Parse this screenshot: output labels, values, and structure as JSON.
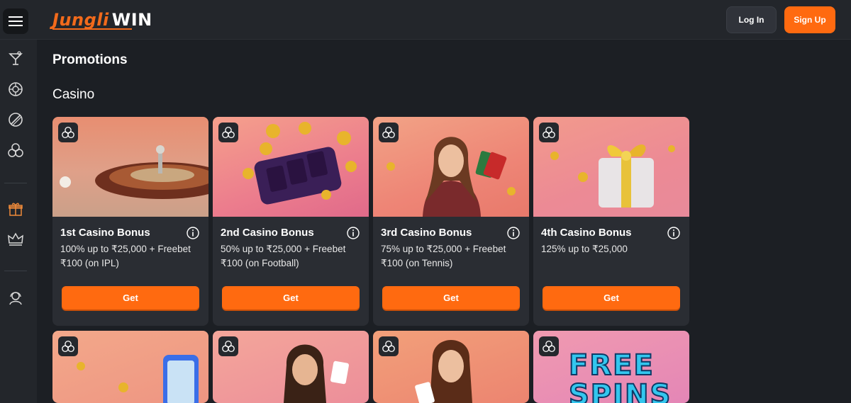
{
  "header": {
    "logo_part1": "Jungli",
    "logo_part2": "WIN",
    "login_label": "Log In",
    "signup_label": "Sign Up"
  },
  "sidebar": {
    "items": [
      {
        "icon": "cocktail-icon"
      },
      {
        "icon": "roulette-icon"
      },
      {
        "icon": "cricket-icon"
      },
      {
        "icon": "casino-chips-icon"
      },
      {
        "icon": "gift-icon"
      },
      {
        "icon": "crown-icon"
      },
      {
        "icon": "support-agent-icon"
      }
    ]
  },
  "main": {
    "page_title": "Promotions",
    "section_title": "Casino",
    "cards": [
      {
        "title": "1st Casino Bonus",
        "desc": "100% up to ₹25,000 + Freebet ₹100 (on IPL)",
        "button": "Get"
      },
      {
        "title": "2nd Casino Bonus",
        "desc": "50% up to ₹25,000 + Freebet ₹100 (on Football)",
        "button": "Get"
      },
      {
        "title": "3rd Casino Bonus",
        "desc": "75% up to ₹25,000 + Freebet ₹100 (on Tennis)",
        "button": "Get"
      },
      {
        "title": "4th Casino Bonus",
        "desc": "125% up to ₹25,000",
        "button": "Get"
      }
    ],
    "row2": {
      "free_spins_text": "FREE SPINS"
    }
  },
  "colors": {
    "accent": "#ff6a10",
    "background": "#1c1f24",
    "card": "#2a2d33"
  }
}
